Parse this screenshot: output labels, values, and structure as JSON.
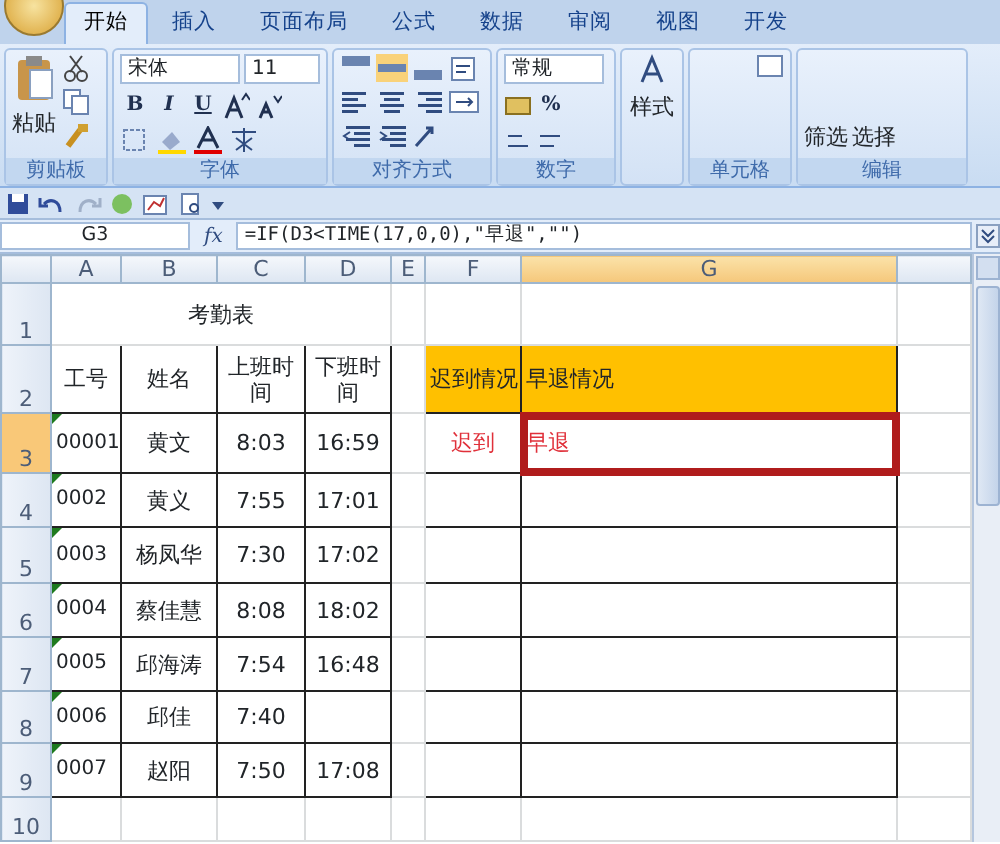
{
  "tabs": [
    {
      "label": "开始",
      "selected": true
    },
    {
      "label": "插入",
      "selected": false
    },
    {
      "label": "页面布局",
      "selected": false
    },
    {
      "label": "公式",
      "selected": false
    },
    {
      "label": "数据",
      "selected": false
    },
    {
      "label": "审阅",
      "selected": false
    },
    {
      "label": "视图",
      "selected": false
    },
    {
      "label": "开发",
      "selected": false
    }
  ],
  "ribbon": {
    "paste": "粘贴",
    "font_name": "宋体",
    "font_size": "11",
    "bold": "B",
    "italic": "I",
    "underline": "U",
    "number_format": "常规",
    "percent": "%",
    "styles": "样式",
    "filter": "筛选",
    "select": "选择",
    "groups": [
      {
        "label": "剪贴板"
      },
      {
        "label": "字体"
      },
      {
        "label": "对齐方式"
      },
      {
        "label": "数字"
      },
      {
        "label": "单元格"
      },
      {
        "label": "编辑"
      }
    ]
  },
  "formula_bar": {
    "name_box": "G3",
    "fx": "fx",
    "formula": "=IF(D3<TIME(17,0,0),\"早退\",\"\")"
  },
  "columns": [
    {
      "label": "A",
      "selected": false
    },
    {
      "label": "B",
      "selected": false
    },
    {
      "label": "C",
      "selected": false
    },
    {
      "label": "D",
      "selected": false
    },
    {
      "label": "E",
      "selected": false
    },
    {
      "label": "F",
      "selected": false
    },
    {
      "label": "G",
      "selected": true
    }
  ],
  "rows": [
    {
      "label": "1",
      "selected": false,
      "cells": [
        {
          "kind": "title",
          "text": "考勤表"
        },
        {
          "kind": "plain"
        },
        {
          "kind": "plain"
        },
        {
          "kind": "plain"
        },
        {
          "kind": "plain"
        }
      ]
    },
    {
      "label": "2",
      "selected": false,
      "cells": [
        {
          "kind": "grid",
          "text": "工号"
        },
        {
          "kind": "grid",
          "text": "姓名"
        },
        {
          "kind": "grid",
          "text": "上班时间"
        },
        {
          "kind": "grid",
          "text": "下班时间"
        },
        {
          "kind": "plain"
        },
        {
          "kind": "header",
          "text": "迟到情况"
        },
        {
          "kind": "header",
          "text": "早退情况"
        },
        {
          "kind": "plain"
        }
      ]
    },
    {
      "label": "3",
      "selected": true,
      "cells": [
        {
          "kind": "grid",
          "text": "00001",
          "flag": true
        },
        {
          "kind": "grid",
          "text": "黄文"
        },
        {
          "kind": "grid",
          "text": "8:03"
        },
        {
          "kind": "grid",
          "text": "16:59"
        },
        {
          "kind": "plain"
        },
        {
          "kind": "grid",
          "text": "迟到",
          "color": "#e0303a"
        },
        {
          "kind": "grid",
          "text": "早退",
          "color": "#e0303a",
          "active": true
        },
        {
          "kind": "plain"
        }
      ]
    },
    {
      "label": "4",
      "selected": false,
      "cells": [
        {
          "kind": "grid",
          "text": "0002",
          "flag": true
        },
        {
          "kind": "grid",
          "text": "黄义"
        },
        {
          "kind": "grid",
          "text": "7:55"
        },
        {
          "kind": "grid",
          "text": "17:01"
        },
        {
          "kind": "plain"
        },
        {
          "kind": "grid"
        },
        {
          "kind": "grid"
        },
        {
          "kind": "plain"
        }
      ]
    },
    {
      "label": "5",
      "selected": false,
      "cells": [
        {
          "kind": "grid",
          "text": "0003",
          "flag": true
        },
        {
          "kind": "grid",
          "text": "杨凤华"
        },
        {
          "kind": "grid",
          "text": "7:30"
        },
        {
          "kind": "grid",
          "text": "17:02"
        },
        {
          "kind": "plain"
        },
        {
          "kind": "grid"
        },
        {
          "kind": "grid"
        },
        {
          "kind": "plain"
        }
      ]
    },
    {
      "label": "6",
      "selected": false,
      "cells": [
        {
          "kind": "grid",
          "text": "0004",
          "flag": true
        },
        {
          "kind": "grid",
          "text": "蔡佳慧"
        },
        {
          "kind": "grid",
          "text": "8:08"
        },
        {
          "kind": "grid",
          "text": "18:02"
        },
        {
          "kind": "plain"
        },
        {
          "kind": "grid"
        },
        {
          "kind": "grid"
        },
        {
          "kind": "plain"
        }
      ]
    },
    {
      "label": "7",
      "selected": false,
      "cells": [
        {
          "kind": "grid",
          "text": "0005",
          "flag": true
        },
        {
          "kind": "grid",
          "text": "邱海涛"
        },
        {
          "kind": "grid",
          "text": "7:54"
        },
        {
          "kind": "grid",
          "text": "16:48"
        },
        {
          "kind": "plain"
        },
        {
          "kind": "grid"
        },
        {
          "kind": "grid"
        },
        {
          "kind": "plain"
        }
      ]
    },
    {
      "label": "8",
      "selected": false,
      "cells": [
        {
          "kind": "grid",
          "text": "0006",
          "flag": true
        },
        {
          "kind": "grid",
          "text": "邱佳"
        },
        {
          "kind": "grid",
          "text": "7:40"
        },
        {
          "kind": "grid"
        },
        {
          "kind": "plain"
        },
        {
          "kind": "grid"
        },
        {
          "kind": "grid"
        },
        {
          "kind": "plain"
        }
      ]
    },
    {
      "label": "9",
      "selected": false,
      "cells": [
        {
          "kind": "grid",
          "text": "0007",
          "flag": true
        },
        {
          "kind": "grid",
          "text": "赵阳"
        },
        {
          "kind": "grid",
          "text": "7:50"
        },
        {
          "kind": "grid",
          "text": "17:08"
        },
        {
          "kind": "plain"
        },
        {
          "kind": "grid"
        },
        {
          "kind": "grid"
        },
        {
          "kind": "plain"
        }
      ]
    },
    {
      "label": "10",
      "selected": false,
      "cells": [
        {
          "kind": "plain"
        },
        {
          "kind": "plain"
        },
        {
          "kind": "plain"
        },
        {
          "kind": "plain"
        },
        {
          "kind": "plain"
        },
        {
          "kind": "plain"
        },
        {
          "kind": "plain"
        },
        {
          "kind": "plain"
        }
      ]
    }
  ]
}
